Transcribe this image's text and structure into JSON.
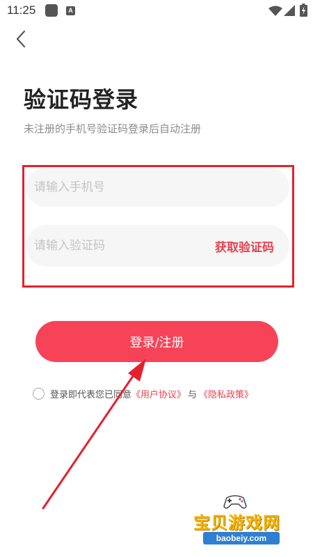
{
  "status_bar": {
    "time": "11:25",
    "badge_letter": "A",
    "icons": [
      "app-icon",
      "a-icon",
      "wifi-icon",
      "signal-icon",
      "battery-icon"
    ]
  },
  "header": {
    "back_icon": "chevron-left-icon"
  },
  "page": {
    "title": "验证码登录",
    "subtitle": "未注册的手机号验证码登录后自动注册"
  },
  "form": {
    "phone_placeholder": "请输入手机号",
    "phone_value": "",
    "code_placeholder": "请输入验证码",
    "code_value": "",
    "get_code_label": "获取验证码",
    "login_label": "登录/注册"
  },
  "agreement": {
    "checked": false,
    "prefix": "登录即代表您已同意",
    "user_agreement": "《用户协议》",
    "and": "与",
    "privacy_policy": "《隐私政策》"
  },
  "watermark": {
    "brand": "宝贝游戏网",
    "domain": "baobeiy.com"
  },
  "colors": {
    "accent": "#f74358",
    "link": "#e8424f",
    "annotation": "#e5202c",
    "field_bg": "#f6f6f6"
  }
}
